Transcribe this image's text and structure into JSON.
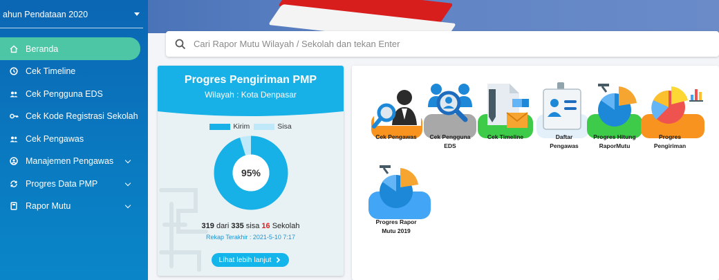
{
  "sidebar": {
    "year_select": "ahun Pendataan 2020",
    "items": [
      {
        "label": "Beranda",
        "icon": "home-icon",
        "active": true
      },
      {
        "label": "Cek Timeline",
        "icon": "clock-icon"
      },
      {
        "label": "Cek Pengguna EDS",
        "icon": "users-icon"
      },
      {
        "label": "Cek Kode Registrasi Sekolah",
        "icon": "key-icon"
      },
      {
        "label": "Cek Pengawas",
        "icon": "users-icon"
      },
      {
        "label": "Manajemen Pengawas",
        "icon": "user-circle-icon",
        "expandable": true
      },
      {
        "label": "Progres Data PMP",
        "icon": "sync-icon",
        "expandable": true
      },
      {
        "label": "Rapor Mutu",
        "icon": "book-icon",
        "expandable": true
      }
    ]
  },
  "search": {
    "placeholder": "Cari Rapor Mutu Wilayah / Sekolah dan tekan Enter"
  },
  "progress_card": {
    "title": "Progres Pengiriman PMP",
    "subtitle": "Wilayah : Kota Denpasar",
    "legend": {
      "sent": "Kirim",
      "remaining": "Sisa"
    },
    "percent_label": "95%",
    "percent_value": 95,
    "sent": "319",
    "of_text": " dari ",
    "total": "335",
    "remaining_text": " sisa ",
    "remaining": "16",
    "unit": " Sekolah",
    "recap": "Rekap Terakhir : 2021-5-10 7:17",
    "more_button": "Lihat lebih lanjut",
    "colors": {
      "sent": "#17b1e8",
      "remaining": "#bfe9f8"
    }
  },
  "menu": {
    "tiles": [
      {
        "label1": "Cek Pengawas",
        "label2": "",
        "icon": "inspector-icon"
      },
      {
        "label1": "Cek Pengguna",
        "label2": "EDS",
        "icon": "user-search-icon"
      },
      {
        "label1": "Cek Timeline",
        "label2": "",
        "icon": "document-icon"
      },
      {
        "label1": "Daftar",
        "label2": "Pengawas",
        "icon": "id-card-icon"
      },
      {
        "label1": "Progres Hitung",
        "label2": "RaporMutu",
        "icon": "pie-chart-icon"
      },
      {
        "label1": "Progres",
        "label2": "Pengiriman",
        "icon": "charts-icon"
      },
      {
        "label1": "Progres Rapor",
        "label2": "Mutu 2019",
        "icon": "pie-chart-icon"
      }
    ]
  }
}
